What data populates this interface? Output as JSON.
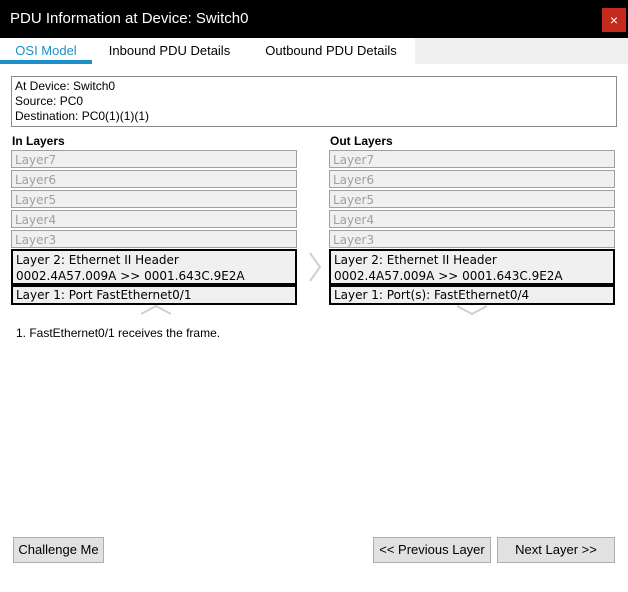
{
  "window": {
    "title": "PDU Information at Device: Switch0",
    "close_label": "×",
    "close_color": "#c42b1c"
  },
  "tabs": [
    {
      "label": "OSI Model",
      "active": true
    },
    {
      "label": "Inbound PDU Details",
      "active": false
    },
    {
      "label": "Outbound PDU Details",
      "active": false
    }
  ],
  "info": {
    "device": "At Device: Switch0",
    "source": "Source: PC0",
    "destination": "Destination: PC0(1)(1)(1)"
  },
  "in_layers": {
    "heading": "In Layers",
    "layer7": "Layer7",
    "layer6": "Layer6",
    "layer5": "Layer5",
    "layer4": "Layer4",
    "layer3": "Layer3",
    "layer2_line1": "Layer 2: Ethernet II Header",
    "layer2_line2": "0002.4A57.009A >> 0001.643C.9E2A",
    "layer1": "Layer 1: Port FastEthernet0/1"
  },
  "out_layers": {
    "heading": "Out Layers",
    "layer7": "Layer7",
    "layer6": "Layer6",
    "layer5": "Layer5",
    "layer4": "Layer4",
    "layer3": "Layer3",
    "layer2_line1": "Layer 2: Ethernet II Header",
    "layer2_line2": "0002.4A57.009A >> 0001.643C.9E2A",
    "layer1": "Layer 1: Port(s): FastEthernet0/4"
  },
  "description": "1. FastEthernet0/1 receives the frame.",
  "buttons": {
    "challenge": "Challenge Me",
    "previous": "<< Previous Layer",
    "next": "Next Layer >>"
  },
  "icons": [
    "close-icon",
    "chevron-right-icon",
    "chevron-up-icon",
    "chevron-down-icon"
  ],
  "colors": {
    "accent": "#1e8fc8",
    "titlebar": "#000000"
  }
}
